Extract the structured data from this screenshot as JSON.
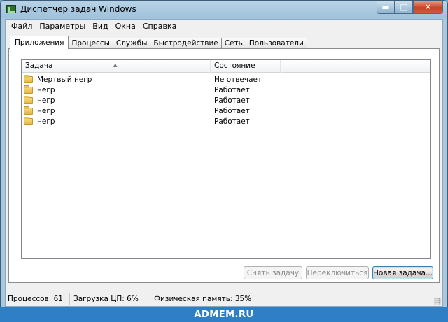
{
  "window": {
    "title": "Диспетчер задач Windows",
    "caption": {
      "minimize": "▬",
      "maximize": "□",
      "close": "✕"
    }
  },
  "menu": [
    "Файл",
    "Параметры",
    "Вид",
    "Окна",
    "Справка"
  ],
  "tabs": [
    {
      "label": "Приложения",
      "active": true
    },
    {
      "label": "Процессы",
      "active": false
    },
    {
      "label": "Службы",
      "active": false
    },
    {
      "label": "Быстродействие",
      "active": false
    },
    {
      "label": "Сеть",
      "active": false
    },
    {
      "label": "Пользователи",
      "active": false
    }
  ],
  "list": {
    "columns": {
      "task": "Задача",
      "status": "Состояние"
    },
    "sort_indicator": "▲",
    "rows": [
      {
        "task": "Мертвый негр",
        "status": "Не отвечает"
      },
      {
        "task": "негр",
        "status": "Работает"
      },
      {
        "task": "негр",
        "status": "Работает"
      },
      {
        "task": "негр",
        "status": "Работает"
      },
      {
        "task": "негр",
        "status": "Работает"
      }
    ]
  },
  "buttons": {
    "end_task": "Снять задачу",
    "switch_to": "Переключиться",
    "new_task": "Новая задача..."
  },
  "statusbar": {
    "processes": "Процессов: 61",
    "cpu": "Загрузка ЦП: 6%",
    "memory": "Физическая память: 35%"
  },
  "watermark": "ADMEM.RU"
}
